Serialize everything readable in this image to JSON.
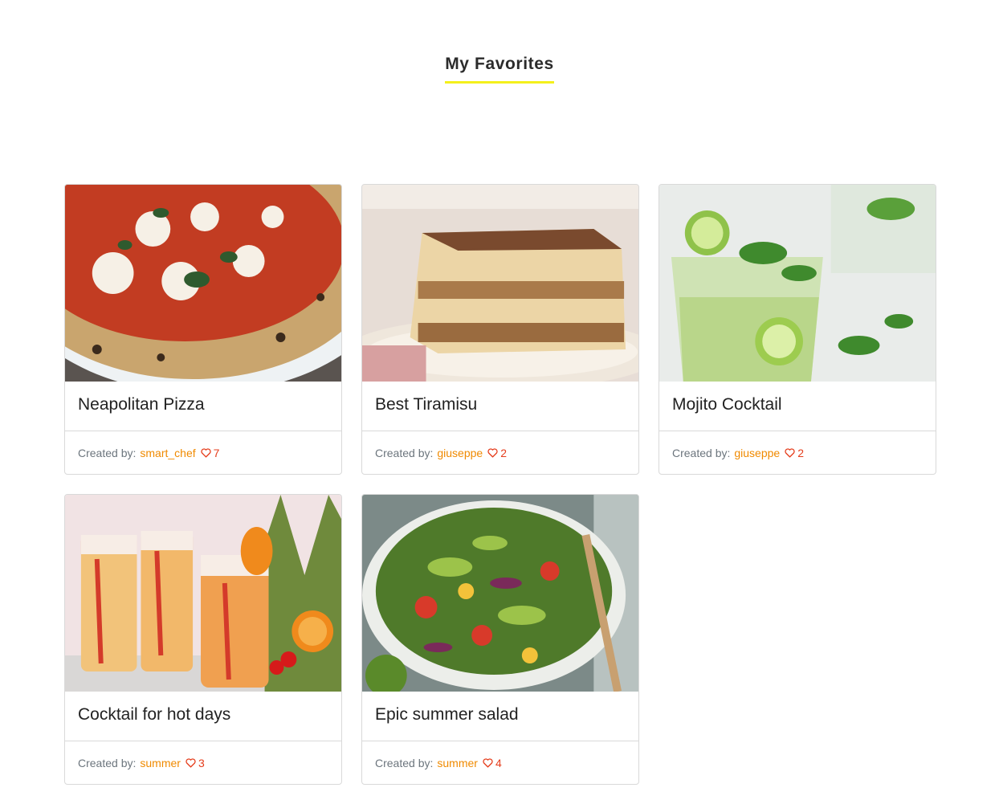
{
  "page": {
    "title": "My Favorites"
  },
  "labels": {
    "created_by": "Created by:"
  },
  "colors": {
    "accent_underline": "#f4f01c",
    "author": "#f08a00",
    "likes": "#e53d1c"
  },
  "recipes": [
    {
      "title": "Neapolitan Pizza",
      "author": "smart_chef",
      "likes": "7",
      "image": "pizza-photo"
    },
    {
      "title": "Best Tiramisu",
      "author": "giuseppe",
      "likes": "2",
      "image": "tiramisu-photo"
    },
    {
      "title": "Mojito Cocktail",
      "author": "giuseppe",
      "likes": "2",
      "image": "mojito-photo"
    },
    {
      "title": "Cocktail for hot days",
      "author": "summer",
      "likes": "3",
      "image": "cocktail-photo"
    },
    {
      "title": "Epic summer salad",
      "author": "summer",
      "likes": "4",
      "image": "salad-photo"
    }
  ]
}
